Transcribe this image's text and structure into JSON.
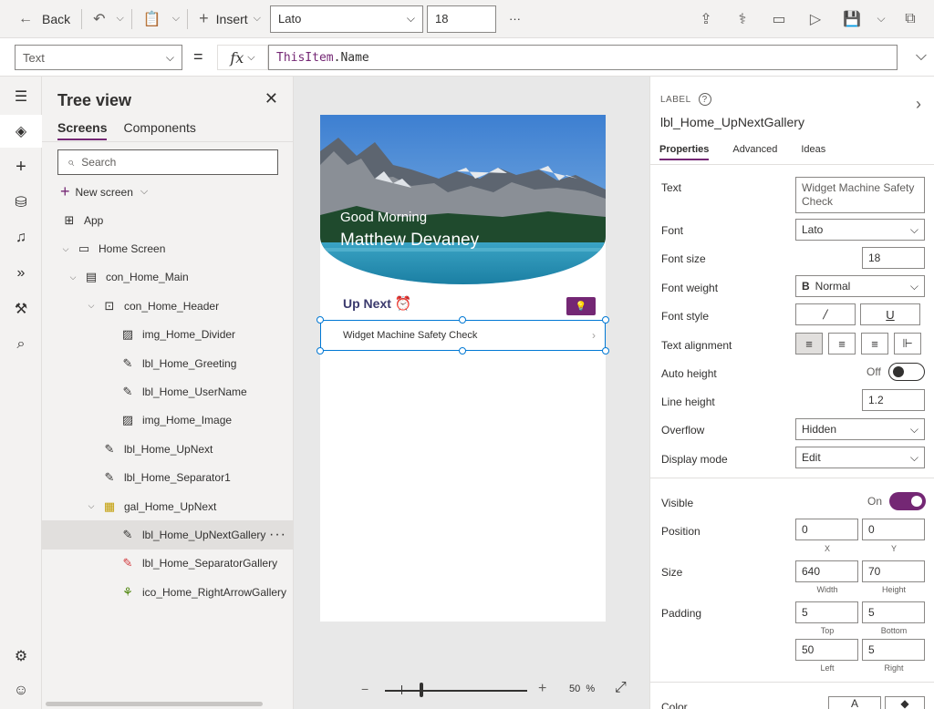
{
  "toolbar": {
    "back_label": "Back",
    "insert_label": "Insert",
    "font_value": "Lato",
    "font_size_value": "18",
    "more_label": "···"
  },
  "formula_bar": {
    "property": "Text",
    "equals": "=",
    "fx": "fx",
    "formula_part1": "ThisItem",
    "formula_part2": ".Name"
  },
  "tree": {
    "title": "Tree view",
    "tabs": [
      "Screens",
      "Components"
    ],
    "search_placeholder": "Search",
    "new_screen_label": "New screen",
    "items": [
      {
        "label": "App",
        "icon": "app-icon",
        "level": 0,
        "caret": ""
      },
      {
        "label": "Home Screen",
        "icon": "screen-icon",
        "level": 0,
        "caret": "v"
      },
      {
        "label": "con_Home_Main",
        "icon": "container-icon",
        "level": 1,
        "caret": "v"
      },
      {
        "label": "con_Home_Header",
        "icon": "group-icon",
        "level": 2,
        "caret": "v"
      },
      {
        "label": "img_Home_Divider",
        "icon": "image-icon",
        "level": 3,
        "caret": ""
      },
      {
        "label": "lbl_Home_Greeting",
        "icon": "label-icon",
        "level": 3,
        "caret": ""
      },
      {
        "label": "lbl_Home_UserName",
        "icon": "label-icon",
        "level": 3,
        "caret": ""
      },
      {
        "label": "img_Home_Image",
        "icon": "image-icon",
        "level": 3,
        "caret": ""
      },
      {
        "label": "lbl_Home_UpNext",
        "icon": "label-icon",
        "level": 2,
        "caret": ""
      },
      {
        "label": "lbl_Home_Separator1",
        "icon": "label-icon",
        "level": 2,
        "caret": ""
      },
      {
        "label": "gal_Home_UpNext",
        "icon": "gallery-icon",
        "level": 2,
        "caret": "v"
      },
      {
        "label": "lbl_Home_UpNextGallery",
        "icon": "label-icon",
        "level": 3,
        "caret": "",
        "selected": true
      },
      {
        "label": "lbl_Home_SeparatorGallery",
        "icon": "label-warning-icon",
        "level": 3,
        "caret": ""
      },
      {
        "label": "ico_Home_RightArrowGallery",
        "icon": "icons-icon",
        "level": 3,
        "caret": ""
      }
    ]
  },
  "canvas": {
    "greeting": "Good Morning",
    "username": "Matthew Devaney",
    "upnext": "Up Next",
    "gallery_item": "Widget Machine Safety Check",
    "zoom_value": "50",
    "zoom_unit": "%"
  },
  "props": {
    "type": "LABEL",
    "name": "lbl_Home_UpNextGallery",
    "tabs": [
      "Properties",
      "Advanced",
      "Ideas"
    ],
    "text_label": "Text",
    "text_value": "Widget Machine Safety Check",
    "font_label": "Font",
    "font_value": "Lato",
    "font_size_label": "Font size",
    "font_size_value": "18",
    "font_weight_label": "Font weight",
    "font_weight_value": "Normal",
    "font_weight_glyph": "B",
    "font_style_label": "Font style",
    "text_alignment_label": "Text alignment",
    "auto_height_label": "Auto height",
    "auto_height_value": "Off",
    "line_height_label": "Line height",
    "line_height_value": "1.2",
    "overflow_label": "Overflow",
    "overflow_value": "Hidden",
    "display_mode_label": "Display mode",
    "display_mode_value": "Edit",
    "visible_label": "Visible",
    "visible_value": "On",
    "position_label": "Position",
    "position_x": "0",
    "position_y": "0",
    "x_label": "X",
    "y_label": "Y",
    "size_label": "Size",
    "width_value": "640",
    "height_value": "70",
    "width_label": "Width",
    "height_label": "Height",
    "padding_label": "Padding",
    "pad_top": "5",
    "pad_bottom": "5",
    "pad_left": "50",
    "pad_right": "5",
    "top_label": "Top",
    "bottom_label": "Bottom",
    "left_label": "Left",
    "right_label": "Right",
    "color_label": "Color",
    "color_glyph": "A"
  },
  "colors": {
    "accent": "#742774",
    "selection": "#0078d4"
  }
}
